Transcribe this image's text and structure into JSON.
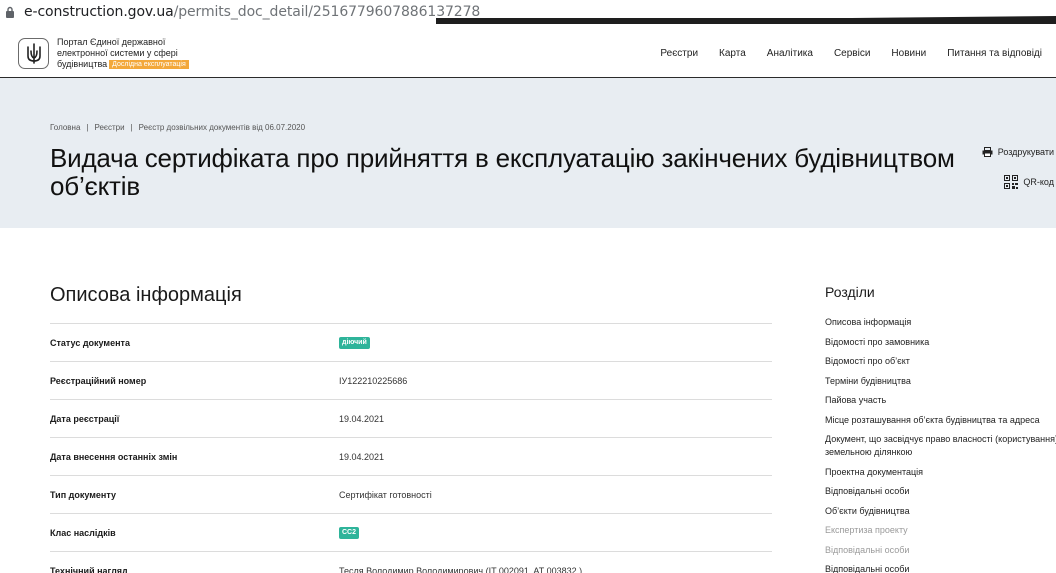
{
  "browser": {
    "url_domain": "e-construction.gov.ua",
    "url_path": "/permits_doc_detail/2516779607886137278"
  },
  "header": {
    "portal_line1": "Портал Єдиної державної",
    "portal_line2": "електронної системи у сфері",
    "portal_line3": "будівництва",
    "beta_badge": "Дослідна експлуатація",
    "nav": [
      "Реєстри",
      "Карта",
      "Аналітика",
      "Сервіси",
      "Новини",
      "Питання та відповіді"
    ]
  },
  "hero": {
    "breadcrumbs": [
      "Головна",
      "Реєстри",
      "Реєстр дозвільних документів від 06.07.2020"
    ],
    "title": "Видача сертифіката про прийняття в експлуатацію закінчених будівництвом об’єктів",
    "print_label": "Роздрукувати",
    "qr_label": "QR-код"
  },
  "main": {
    "section_title": "Описова інформація",
    "rows": [
      {
        "label": "Статус документа",
        "value": "діючий",
        "chip": true
      },
      {
        "label": "Реєстраційний номер",
        "value": "ІУ122210225686",
        "chip": false
      },
      {
        "label": "Дата реєстрації",
        "value": "19.04.2021",
        "chip": false
      },
      {
        "label": "Дата внесення останніх змін",
        "value": "19.04.2021",
        "chip": false
      },
      {
        "label": "Тип документу",
        "value": "Сертифікат готовності",
        "chip": false
      },
      {
        "label": "Клас наслідків",
        "value": "СС2",
        "chip": true
      },
      {
        "label": "Технічний нагляд",
        "value": "Тесля Володимир Володимирович (IT 002091, AT 003832 )",
        "chip": false
      }
    ]
  },
  "sidebar": {
    "title": "Розділи",
    "items": [
      {
        "label": "Описова інформація",
        "muted": false
      },
      {
        "label": "Відомості про замовника",
        "muted": false
      },
      {
        "label": "Відомості про об’єкт",
        "muted": false
      },
      {
        "label": "Терміни будівництва",
        "muted": false
      },
      {
        "label": "Пайова участь",
        "muted": false
      },
      {
        "label": "Місце розташування об’єкта будівництва та адреса",
        "muted": false
      },
      {
        "label": "Документ, що засвідчує право власності (користування) земельною ділянкою",
        "muted": false
      },
      {
        "label": "Проектна документація",
        "muted": false
      },
      {
        "label": "Відповідальні особи",
        "muted": false
      },
      {
        "label": "Об’єкти будівництва",
        "muted": false
      },
      {
        "label": "Експертиза проекту",
        "muted": true
      },
      {
        "label": "Відповідальні особи",
        "muted": true
      },
      {
        "label": "Відповідальні особи",
        "muted": false
      }
    ]
  },
  "colors": {
    "chip_green": "#2eb49a",
    "beta_orange": "#f3a83b",
    "hero_bg": "#e8edf2"
  }
}
